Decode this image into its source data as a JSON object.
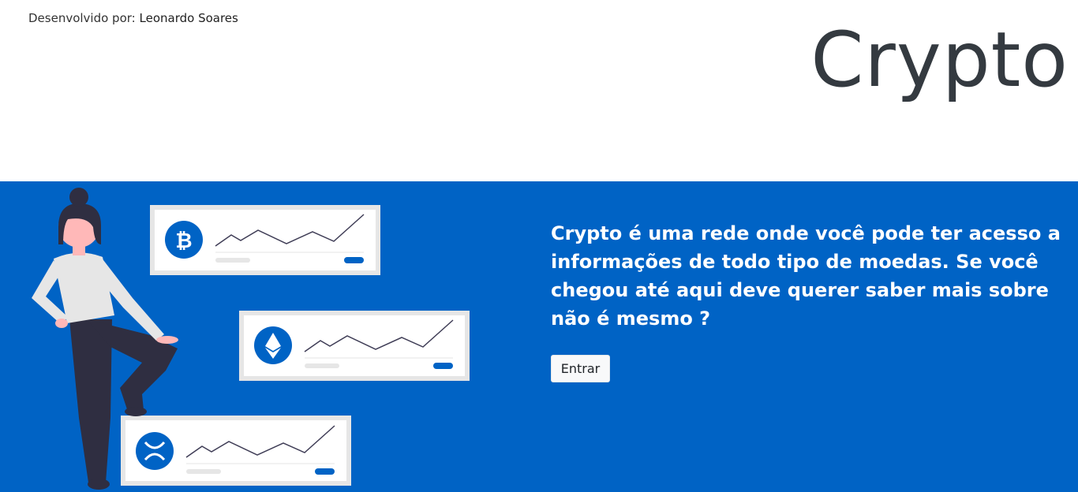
{
  "header": {
    "credit_prefix": "Desenvolvido por:",
    "credit_author": "Leonardo Soares",
    "brand": "Crypto"
  },
  "hero": {
    "description": "Crypto é uma rede onde você pode ter acesso a informações de todo tipo de moedas. Se você chegou até aqui deve querer saber mais sobre não é mesmo ?",
    "button_label": "Entrar",
    "illustration": {
      "cards": [
        {
          "coin_icon": "bitcoin-icon"
        },
        {
          "coin_icon": "ethereum-icon"
        },
        {
          "coin_icon": "ripple-icon"
        }
      ]
    }
  },
  "colors": {
    "hero_background": "#0063c5",
    "accent": "#0063c5",
    "brand_text": "#343a40"
  }
}
